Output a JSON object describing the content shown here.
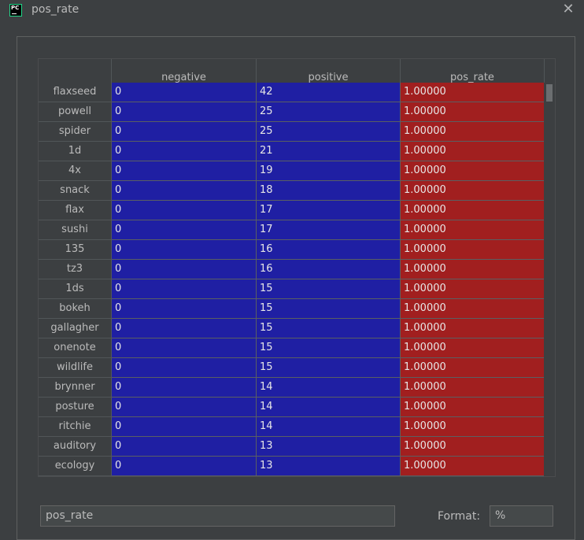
{
  "window": {
    "title": "pos_rate",
    "icon": "pycharm-icon",
    "icon_text": "PC",
    "close_glyph": "✕"
  },
  "table": {
    "columns": [
      "negative",
      "positive",
      "pos_rate"
    ],
    "colors": {
      "negative": "#1f1fa3",
      "positive": "#1f1fa3",
      "pos_rate": "#a11f1f"
    },
    "rows": [
      {
        "index": "flaxseed",
        "negative": "0",
        "positive": "42",
        "pos_rate": "1.00000"
      },
      {
        "index": "powell",
        "negative": "0",
        "positive": "25",
        "pos_rate": "1.00000"
      },
      {
        "index": "spider",
        "negative": "0",
        "positive": "25",
        "pos_rate": "1.00000"
      },
      {
        "index": "1d",
        "negative": "0",
        "positive": "21",
        "pos_rate": "1.00000"
      },
      {
        "index": "4x",
        "negative": "0",
        "positive": "19",
        "pos_rate": "1.00000"
      },
      {
        "index": "snack",
        "negative": "0",
        "positive": "18",
        "pos_rate": "1.00000"
      },
      {
        "index": "flax",
        "negative": "0",
        "positive": "17",
        "pos_rate": "1.00000"
      },
      {
        "index": "sushi",
        "negative": "0",
        "positive": "17",
        "pos_rate": "1.00000"
      },
      {
        "index": "135",
        "negative": "0",
        "positive": "16",
        "pos_rate": "1.00000"
      },
      {
        "index": "tz3",
        "negative": "0",
        "positive": "16",
        "pos_rate": "1.00000"
      },
      {
        "index": "1ds",
        "negative": "0",
        "positive": "15",
        "pos_rate": "1.00000"
      },
      {
        "index": "bokeh",
        "negative": "0",
        "positive": "15",
        "pos_rate": "1.00000"
      },
      {
        "index": "gallagher",
        "negative": "0",
        "positive": "15",
        "pos_rate": "1.00000"
      },
      {
        "index": "onenote",
        "negative": "0",
        "positive": "15",
        "pos_rate": "1.00000"
      },
      {
        "index": "wildlife",
        "negative": "0",
        "positive": "15",
        "pos_rate": "1.00000"
      },
      {
        "index": "brynner",
        "negative": "0",
        "positive": "14",
        "pos_rate": "1.00000"
      },
      {
        "index": "posture",
        "negative": "0",
        "positive": "14",
        "pos_rate": "1.00000"
      },
      {
        "index": "ritchie",
        "negative": "0",
        "positive": "14",
        "pos_rate": "1.00000"
      },
      {
        "index": "auditory",
        "negative": "0",
        "positive": "13",
        "pos_rate": "1.00000"
      },
      {
        "index": "ecology",
        "negative": "0",
        "positive": "13",
        "pos_rate": "1.00000"
      }
    ]
  },
  "footer": {
    "name_value": "pos_rate",
    "format_label": "Format:",
    "format_value": "%"
  }
}
